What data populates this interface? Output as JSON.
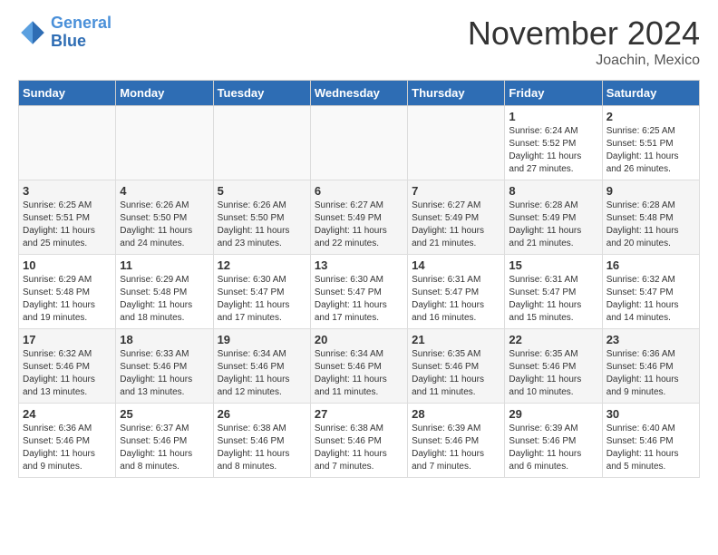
{
  "logo": {
    "line1": "General",
    "line2": "Blue"
  },
  "title": "November 2024",
  "location": "Joachin, Mexico",
  "headers": [
    "Sunday",
    "Monday",
    "Tuesday",
    "Wednesday",
    "Thursday",
    "Friday",
    "Saturday"
  ],
  "weeks": [
    [
      {
        "day": "",
        "info": ""
      },
      {
        "day": "",
        "info": ""
      },
      {
        "day": "",
        "info": ""
      },
      {
        "day": "",
        "info": ""
      },
      {
        "day": "",
        "info": ""
      },
      {
        "day": "1",
        "info": "Sunrise: 6:24 AM\nSunset: 5:52 PM\nDaylight: 11 hours and 27 minutes."
      },
      {
        "day": "2",
        "info": "Sunrise: 6:25 AM\nSunset: 5:51 PM\nDaylight: 11 hours and 26 minutes."
      }
    ],
    [
      {
        "day": "3",
        "info": "Sunrise: 6:25 AM\nSunset: 5:51 PM\nDaylight: 11 hours and 25 minutes."
      },
      {
        "day": "4",
        "info": "Sunrise: 6:26 AM\nSunset: 5:50 PM\nDaylight: 11 hours and 24 minutes."
      },
      {
        "day": "5",
        "info": "Sunrise: 6:26 AM\nSunset: 5:50 PM\nDaylight: 11 hours and 23 minutes."
      },
      {
        "day": "6",
        "info": "Sunrise: 6:27 AM\nSunset: 5:49 PM\nDaylight: 11 hours and 22 minutes."
      },
      {
        "day": "7",
        "info": "Sunrise: 6:27 AM\nSunset: 5:49 PM\nDaylight: 11 hours and 21 minutes."
      },
      {
        "day": "8",
        "info": "Sunrise: 6:28 AM\nSunset: 5:49 PM\nDaylight: 11 hours and 21 minutes."
      },
      {
        "day": "9",
        "info": "Sunrise: 6:28 AM\nSunset: 5:48 PM\nDaylight: 11 hours and 20 minutes."
      }
    ],
    [
      {
        "day": "10",
        "info": "Sunrise: 6:29 AM\nSunset: 5:48 PM\nDaylight: 11 hours and 19 minutes."
      },
      {
        "day": "11",
        "info": "Sunrise: 6:29 AM\nSunset: 5:48 PM\nDaylight: 11 hours and 18 minutes."
      },
      {
        "day": "12",
        "info": "Sunrise: 6:30 AM\nSunset: 5:47 PM\nDaylight: 11 hours and 17 minutes."
      },
      {
        "day": "13",
        "info": "Sunrise: 6:30 AM\nSunset: 5:47 PM\nDaylight: 11 hours and 17 minutes."
      },
      {
        "day": "14",
        "info": "Sunrise: 6:31 AM\nSunset: 5:47 PM\nDaylight: 11 hours and 16 minutes."
      },
      {
        "day": "15",
        "info": "Sunrise: 6:31 AM\nSunset: 5:47 PM\nDaylight: 11 hours and 15 minutes."
      },
      {
        "day": "16",
        "info": "Sunrise: 6:32 AM\nSunset: 5:47 PM\nDaylight: 11 hours and 14 minutes."
      }
    ],
    [
      {
        "day": "17",
        "info": "Sunrise: 6:32 AM\nSunset: 5:46 PM\nDaylight: 11 hours and 13 minutes."
      },
      {
        "day": "18",
        "info": "Sunrise: 6:33 AM\nSunset: 5:46 PM\nDaylight: 11 hours and 13 minutes."
      },
      {
        "day": "19",
        "info": "Sunrise: 6:34 AM\nSunset: 5:46 PM\nDaylight: 11 hours and 12 minutes."
      },
      {
        "day": "20",
        "info": "Sunrise: 6:34 AM\nSunset: 5:46 PM\nDaylight: 11 hours and 11 minutes."
      },
      {
        "day": "21",
        "info": "Sunrise: 6:35 AM\nSunset: 5:46 PM\nDaylight: 11 hours and 11 minutes."
      },
      {
        "day": "22",
        "info": "Sunrise: 6:35 AM\nSunset: 5:46 PM\nDaylight: 11 hours and 10 minutes."
      },
      {
        "day": "23",
        "info": "Sunrise: 6:36 AM\nSunset: 5:46 PM\nDaylight: 11 hours and 9 minutes."
      }
    ],
    [
      {
        "day": "24",
        "info": "Sunrise: 6:36 AM\nSunset: 5:46 PM\nDaylight: 11 hours and 9 minutes."
      },
      {
        "day": "25",
        "info": "Sunrise: 6:37 AM\nSunset: 5:46 PM\nDaylight: 11 hours and 8 minutes."
      },
      {
        "day": "26",
        "info": "Sunrise: 6:38 AM\nSunset: 5:46 PM\nDaylight: 11 hours and 8 minutes."
      },
      {
        "day": "27",
        "info": "Sunrise: 6:38 AM\nSunset: 5:46 PM\nDaylight: 11 hours and 7 minutes."
      },
      {
        "day": "28",
        "info": "Sunrise: 6:39 AM\nSunset: 5:46 PM\nDaylight: 11 hours and 7 minutes."
      },
      {
        "day": "29",
        "info": "Sunrise: 6:39 AM\nSunset: 5:46 PM\nDaylight: 11 hours and 6 minutes."
      },
      {
        "day": "30",
        "info": "Sunrise: 6:40 AM\nSunset: 5:46 PM\nDaylight: 11 hours and 5 minutes."
      }
    ]
  ]
}
